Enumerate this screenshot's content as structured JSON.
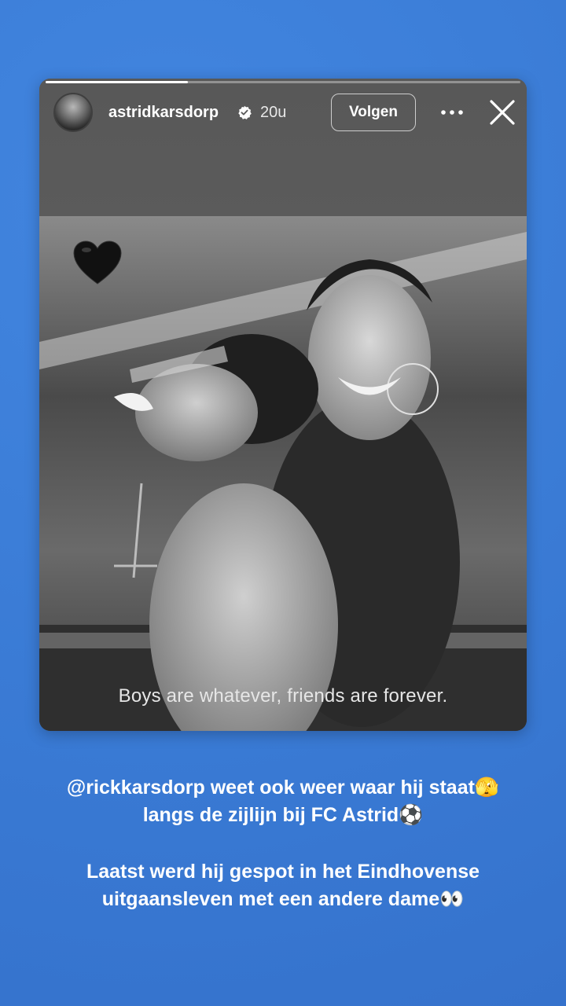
{
  "story": {
    "progress": 0.3,
    "username": "astridkarsdorp",
    "time_ago": "20u",
    "follow_label": "Volgen",
    "photo_caption": "Boys are whatever, friends are forever."
  },
  "caption": {
    "line1": "@rickkarsdorp weet ook weer waar hij staat🫣",
    "line2": "langs de zijlijn bij FC Astrid⚽",
    "line3": "Laatst werd hij gespot in het Eindhovense",
    "line4": "uitgaansleven met een andere dame👀"
  },
  "colors": {
    "background": "#3a7bd5",
    "verified": "#ffffff"
  },
  "icons": [
    "verified-icon",
    "more-icon",
    "close-icon",
    "black-heart-icon"
  ]
}
